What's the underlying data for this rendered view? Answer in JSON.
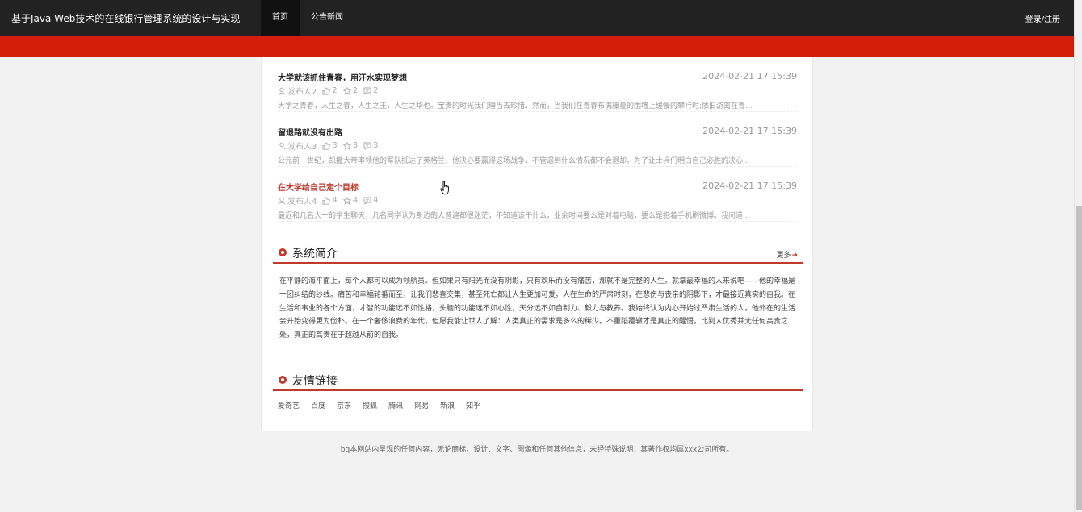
{
  "header": {
    "brand": "基于Java Web技术的在线银行管理系统的设计与实现",
    "nav": [
      {
        "label": "首页",
        "active": true
      },
      {
        "label": "公告新闻",
        "active": false
      }
    ],
    "login_label": "登录/注册"
  },
  "colors": {
    "topbar": "#222222",
    "accent": "#d21d0b",
    "section_accent": "#c0392b"
  },
  "news": [
    {
      "title": "大学就该抓住青春，用汗水实现梦想",
      "time": "2024-02-21 17:15:39",
      "author": "发布人2",
      "likes": "2",
      "favorites": "2",
      "comments": "2",
      "summary": "大学之青春，人生之春，人生之王，人生之华也。宝贵的时光我们理当去珍惜。然而，当我们在青春布满藤蔓的围墙上缓慢的攀行时;依旧游离在青..."
    },
    {
      "title": "留退路就没有出路",
      "time": "2024-02-21 17:15:39",
      "author": "发布人3",
      "likes": "3",
      "favorites": "3",
      "comments": "3",
      "summary": "公元前一世纪，凯撒大帝率领他的军队抵达了英格兰，他决心要赢得这场战争，不管遇到什么情况都不会退却。为了让士兵们明白自己必胜的决心..."
    },
    {
      "title": "在大学给自己定个目标",
      "time": "2024-02-21 17:15:39",
      "author": "发布人4",
      "likes": "4",
      "favorites": "4",
      "comments": "4",
      "summary": "最近和几名大一的学生聊天，几名同学认为身边的人普遍都很迷茫，不知道该干什么，业余时间要么是对着电脑，要么是抱着手机刷微博。我问道..."
    }
  ],
  "intro": {
    "title": "系统简介",
    "more_label": "更多",
    "text": "在平静的海平面上，每个人都可以成为领航员。但如果只有阳光而没有阴影，只有欢乐而没有痛苦，那就不是完整的人生。就拿最幸福的人来说吧——他的幸福是一团纠结的纱线。痛苦和幸福轮番而至，让我们悲喜交集，甚至死亡都让人生更加可爱。人在生命的严肃时刻，在悲伤与丧亲的阴影下，才最接近真实的自我。在生活和事业的各个方面，才智的功能远不如性格，头脑的功能远不如心性，天分远不如自制力、毅力与教养。我始终认为内心开始过严肃生活的人，他外在的生活会开始变得更为俭朴。在一个奢侈浪费的年代，但愿我能让世人了解：人类真正的需求是多么的稀少。不重蹈覆辙才是真正的醒悟。比别人优秀并无任何高贵之处，真正的高贵在于超越从前的自我。"
  },
  "links": {
    "title": "友情链接",
    "items": [
      "爱奇艺",
      "百度",
      "京东",
      "搜狐",
      "腾讯",
      "网易",
      "新浪",
      "知乎"
    ]
  },
  "footer": {
    "text": "bq本网站内呈现的任何内容，无论商标、设计、文字、图像和任何其他信息，未经特殊说明，其著作权均属xxx公司所有。"
  }
}
